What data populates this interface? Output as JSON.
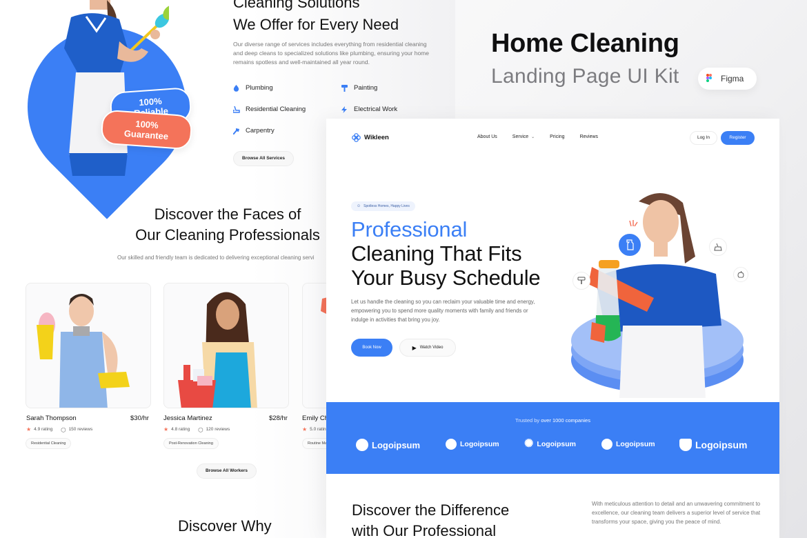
{
  "kit": {
    "title": "Home Cleaning",
    "subtitle": "Landing Page UI Kit",
    "badge_label": "Figma"
  },
  "back_page": {
    "badges": {
      "reliable": "100% Reliable",
      "guarantee": "100% Guarantee"
    },
    "services": {
      "title_line1": "Cleaning Solutions",
      "title_line2": "We Offer for Every Need",
      "description": "Our diverse range of services includes everything from residential cleaning and deep cleans to specialized solutions like plumbing, ensuring your home remains spotless and well-maintained all year round.",
      "items": [
        {
          "label": "Plumbing",
          "icon": "water-drop-icon"
        },
        {
          "label": "Painting",
          "icon": "paint-roller-icon"
        },
        {
          "label": "Residential Cleaning",
          "icon": "vacuum-icon"
        },
        {
          "label": "Electrical Work",
          "icon": "lightning-icon"
        },
        {
          "label": "Carpentry",
          "icon": "hammer-icon"
        }
      ],
      "browse_label": "Browse All Services"
    },
    "team": {
      "title_line1": "Discover the Faces of",
      "title_line2": "Our Cleaning Professionals",
      "subtitle": "Our skilled and friendly team is dedicated to delivering exceptional cleaning servi",
      "workers": [
        {
          "name": "Sarah Thompson",
          "rate": "$30/hr",
          "rating": "4.9 rating",
          "reviews": "150 reviews",
          "tag": "Residential Cleaning"
        },
        {
          "name": "Jessica Martinez",
          "rate": "$28/hr",
          "rating": "4.8 rating",
          "reviews": "120 reviews",
          "tag": "Post-Renovation Cleaning"
        },
        {
          "name": "Emily Ch",
          "rate": "",
          "rating": "5.0 ratin",
          "reviews": "",
          "tag": "Routine Ma"
        }
      ],
      "browse_label": "Browse All Workers"
    },
    "why_title": "Discover Why"
  },
  "front_page": {
    "nav": {
      "brand": "Wikleen",
      "links": [
        "About Us",
        "Service",
        "Pricing",
        "Reviews"
      ],
      "login_label": "Log In",
      "register_label": "Register"
    },
    "hero": {
      "chip": "Spotless Homes, Happy Lives",
      "title_accent": "Professional",
      "title_line2": "Cleaning That Fits",
      "title_line3": "Your Busy Schedule",
      "description": "Let us handle the cleaning so you can reclaim your valuable time and energy, empowering you to spend more quality moments with family and friends or indulge in activities that bring you joy.",
      "primary_cta": "Book Now",
      "secondary_cta": "Watch Video"
    },
    "trusted": {
      "prefix": "Trusted by ",
      "highlight": "over 1000 companies",
      "logos": [
        "Logoipsum",
        "Logoipsum",
        "Logoipsum",
        "Logoipsum",
        "Logoipsum"
      ]
    },
    "difference": {
      "title_line1": "Discover the Difference",
      "title_line2": "with Our Professional",
      "description": "With meticulous attention to detail and an unwavering commitment to excellence, our cleaning team delivers a superior level of service that transforms your space, giving you the peace of mind."
    }
  },
  "colors": {
    "accent_blue": "#3b7ff5",
    "accent_coral": "#f4735a",
    "text_dark": "#121212",
    "text_muted": "#777777"
  }
}
